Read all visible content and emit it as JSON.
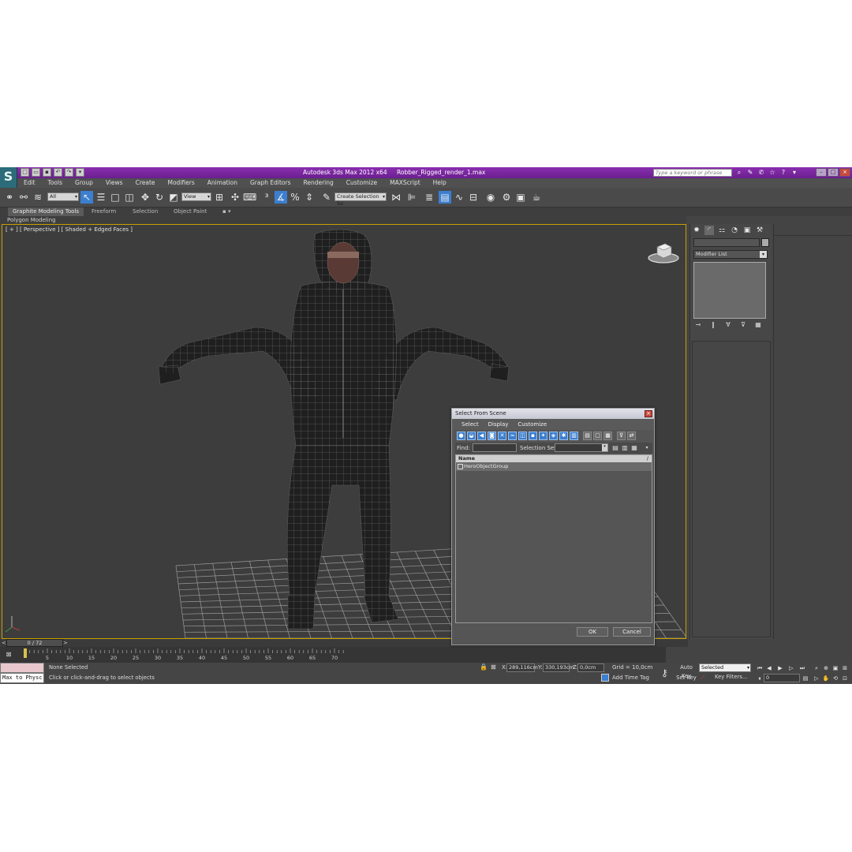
{
  "window": {
    "title_app": "Autodesk 3ds Max  2012 x64",
    "title_file": "Robber_Rigged_render_1.max",
    "search_placeholder": "Type a keyword or phrase"
  },
  "menu": [
    "Edit",
    "Tools",
    "Group",
    "Views",
    "Create",
    "Modifiers",
    "Animation",
    "Graph Editors",
    "Rendering",
    "Customize",
    "MAXScript",
    "Help"
  ],
  "toolbar": {
    "filter_value": "All",
    "ref_coord_value": "View",
    "selection_set_value": "Create Selection Se"
  },
  "ribbon": {
    "tabs": [
      "Graphite Modeling Tools",
      "Freeform",
      "Selection",
      "Object Paint"
    ],
    "subtab": "Polygon Modeling"
  },
  "viewport": {
    "label": "[ + ] [ Perspective ] [ Shaded + Edged Faces ]"
  },
  "command_panel": {
    "modifier_list": "Modifier List"
  },
  "time_slider": {
    "left_arrow": "<",
    "frame_display": "0 / 72",
    "right_arrow": ">",
    "ticks": [
      "0",
      "5",
      "10",
      "15",
      "20",
      "25",
      "30",
      "35",
      "40",
      "45",
      "50",
      "55",
      "60",
      "65",
      "70"
    ]
  },
  "status": {
    "maxscript_line": "Max to Physc.",
    "selection": "None Selected",
    "prompt": "Click or click-and-drag to select objects",
    "x_label": "X:",
    "x_value": "289,116cm",
    "y_label": "Y:",
    "y_value": "330,193cm",
    "z_label": "Z:",
    "z_value": "0,0cm",
    "grid": "Grid = 10,0cm",
    "add_time_tag": "Add Time Tag",
    "auto_key": "Auto Key",
    "set_key": "Set Key",
    "key_mode_value": "Selected",
    "key_filters": "Key Filters...",
    "current_frame": "0"
  },
  "dialog": {
    "title": "Select From Scene",
    "menu": [
      "Select",
      "Display",
      "Customize"
    ],
    "find_label": "Find:",
    "selection_set_label": "Selection Set:",
    "column_name": "Name",
    "rows": [
      "HeroObjectGroup"
    ],
    "ok": "OK",
    "cancel": "Cancel"
  }
}
